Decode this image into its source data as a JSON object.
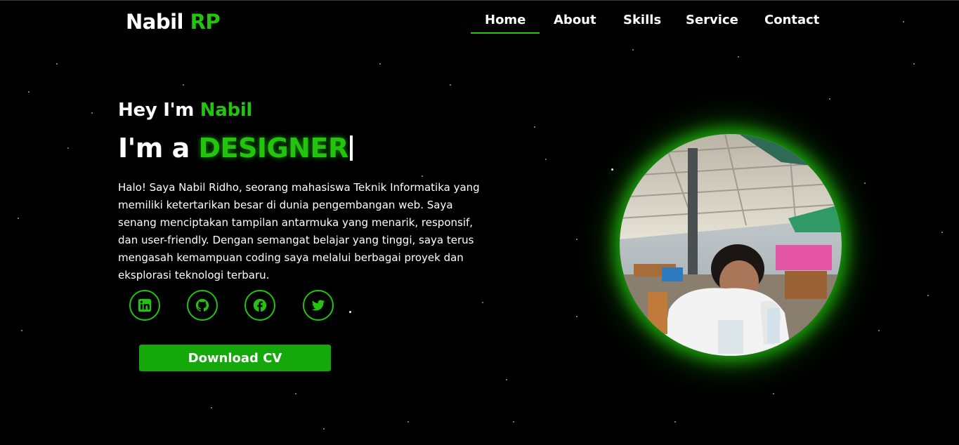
{
  "brand": {
    "first": "Nabil",
    "second": "RP"
  },
  "nav": {
    "items": [
      {
        "label": "Home",
        "active": true
      },
      {
        "label": "About",
        "active": false
      },
      {
        "label": "Skills",
        "active": false
      },
      {
        "label": "Service",
        "active": false
      },
      {
        "label": "Contact",
        "active": false
      }
    ]
  },
  "hero": {
    "greeting_prefix": "Hey I'm",
    "greeting_name": "Nabil",
    "role_prefix": "I'm a",
    "role_word": "DESIGNER",
    "bio_lines": [
      "Halo! Saya Nabil Ridho, seorang mahasiswa Teknik Informatika yang",
      "memiliki ketertarikan besar di dunia pengembangan web. Saya",
      "senang menciptakan tampilan antarmuka yang menarik, responsif,",
      "dan user-friendly. Dengan semangat belajar yang tinggi, saya terus",
      "mengasah kemampuan coding saya melalui berbagai proyek dan",
      "eksplorasi teknologi terbaru."
    ],
    "socials": [
      "linkedin-icon",
      "github-icon",
      "facebook-icon",
      "twitter-icon"
    ],
    "cv_button": "Download CV"
  },
  "theme": {
    "accent": "#22c40d",
    "button": "#14a80a",
    "background": "#000000"
  }
}
